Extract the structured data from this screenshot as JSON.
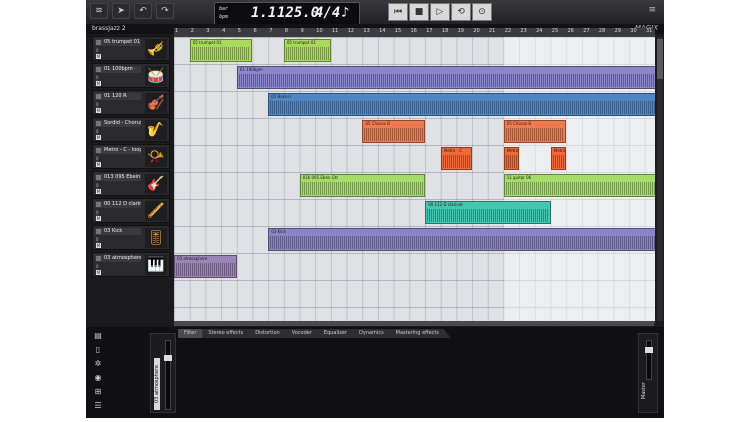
{
  "song": {
    "title": "brassJazz 2"
  },
  "brand": "MAGIX",
  "transport": {
    "position_label": "bar",
    "position": "1.1",
    "tempo_label": "bpm",
    "tempo": "125.0",
    "signature": "4/4",
    "metronome_icon": "note-icon"
  },
  "ruler": [
    "1",
    "2",
    "3",
    "4",
    "5",
    "6",
    "7",
    "8",
    "9",
    "10",
    "11",
    "12",
    "13",
    "14",
    "15",
    "16",
    "17",
    "18",
    "19",
    "20",
    "21",
    "22",
    "23",
    "24",
    "25",
    "26",
    "27",
    "28",
    "29",
    "30",
    "31"
  ],
  "tracks": [
    {
      "name": "05 trumpet 01",
      "vals": [
        "0",
        "0"
      ],
      "mute": "M",
      "instrument": "trumpet-icon",
      "inst_glyph": "🎺"
    },
    {
      "name": "01 100bpm",
      "vals": [
        "0",
        "0"
      ],
      "mute": "M",
      "instrument": "drums-icon",
      "inst_glyph": "🥁"
    },
    {
      "name": "01 120 R",
      "vals": [
        "0",
        "0"
      ],
      "mute": "M",
      "instrument": "bass-icon",
      "inst_glyph": "🎻"
    },
    {
      "name": "Sordid - Chorus B",
      "vals": [
        "0",
        "0"
      ],
      "mute": "M",
      "instrument": "brass-section-icon",
      "inst_glyph": "🎷"
    },
    {
      "name": "Metro - C - loop 01",
      "vals": [
        "0",
        "0"
      ],
      "mute": "M",
      "instrument": "horn-icon",
      "inst_glyph": "📯"
    },
    {
      "name": "013 095 Ebein Gtr",
      "vals": [
        "0",
        "0"
      ],
      "mute": "M",
      "instrument": "guitar-icon",
      "inst_glyph": "🎸"
    },
    {
      "name": "00 112 D clarinet 01",
      "vals": [
        "0",
        "0"
      ],
      "mute": "M",
      "instrument": "clarinet-icon",
      "inst_glyph": "🪈"
    },
    {
      "name": "03 Kick",
      "vals": [
        "0",
        "0"
      ],
      "mute": "M",
      "instrument": "mixer-icon",
      "inst_glyph": "🎚"
    },
    {
      "name": "03 atmosphere",
      "vals": [
        "0",
        "0"
      ],
      "mute": "M",
      "instrument": "keyboard-icon",
      "inst_glyph": "🎹"
    }
  ],
  "parts": [
    {
      "row": 0,
      "start": 1,
      "end": 5,
      "label": "05 trumpet 01",
      "color": "#a9d95b"
    },
    {
      "row": 0,
      "start": 7,
      "end": 10,
      "label": "05 trumpet 01",
      "color": "#a9d95b"
    },
    {
      "row": 1,
      "start": 4,
      "end": 31,
      "label": "01 100bpm",
      "color": "#8a86c9"
    },
    {
      "row": 2,
      "start": 6,
      "end": 31,
      "label": "01 Bass-n",
      "color": "#4f86c8"
    },
    {
      "row": 3,
      "start": 12,
      "end": 16,
      "label": "05 Chorus B",
      "color": "#f07a50"
    },
    {
      "row": 3,
      "start": 21,
      "end": 25,
      "label": "05 Chorus B",
      "color": "#f07a50"
    },
    {
      "row": 4,
      "start": 17,
      "end": 19,
      "label": "Metro - C",
      "color": "#ee6a3a"
    },
    {
      "row": 4,
      "start": 21,
      "end": 22,
      "label": "Metro",
      "color": "#ee6a3a"
    },
    {
      "row": 4,
      "start": 24,
      "end": 25,
      "label": "Metro",
      "color": "#ee6a3a"
    },
    {
      "row": 5,
      "start": 8,
      "end": 16,
      "label": "016 095 Eben Gtr",
      "color": "#a4dc6a"
    },
    {
      "row": 5,
      "start": 21,
      "end": 31,
      "label": "11 guitar 06",
      "color": "#a4dc6a"
    },
    {
      "row": 6,
      "start": 16,
      "end": 24,
      "label": "00 112 D clarinet",
      "color": "#44c6b0"
    },
    {
      "row": 7,
      "start": 6,
      "end": 31,
      "label": "03 Kick",
      "color": "#8c82c8"
    },
    {
      "row": 8,
      "start": 0,
      "end": 4,
      "label": "03 atmosphere",
      "color": "#9c84b6"
    }
  ],
  "bottom": {
    "tabs": [
      "Filter",
      "Stereo effects",
      "Distortion",
      "Vocoder",
      "Equalizer",
      "Dynamics",
      "Mastering effects"
    ],
    "channel_name": "03 atmosphere",
    "master_label": "Master"
  },
  "colors": {
    "accent": "#4f86c8",
    "arrange_bg": "#dfe1e4"
  }
}
